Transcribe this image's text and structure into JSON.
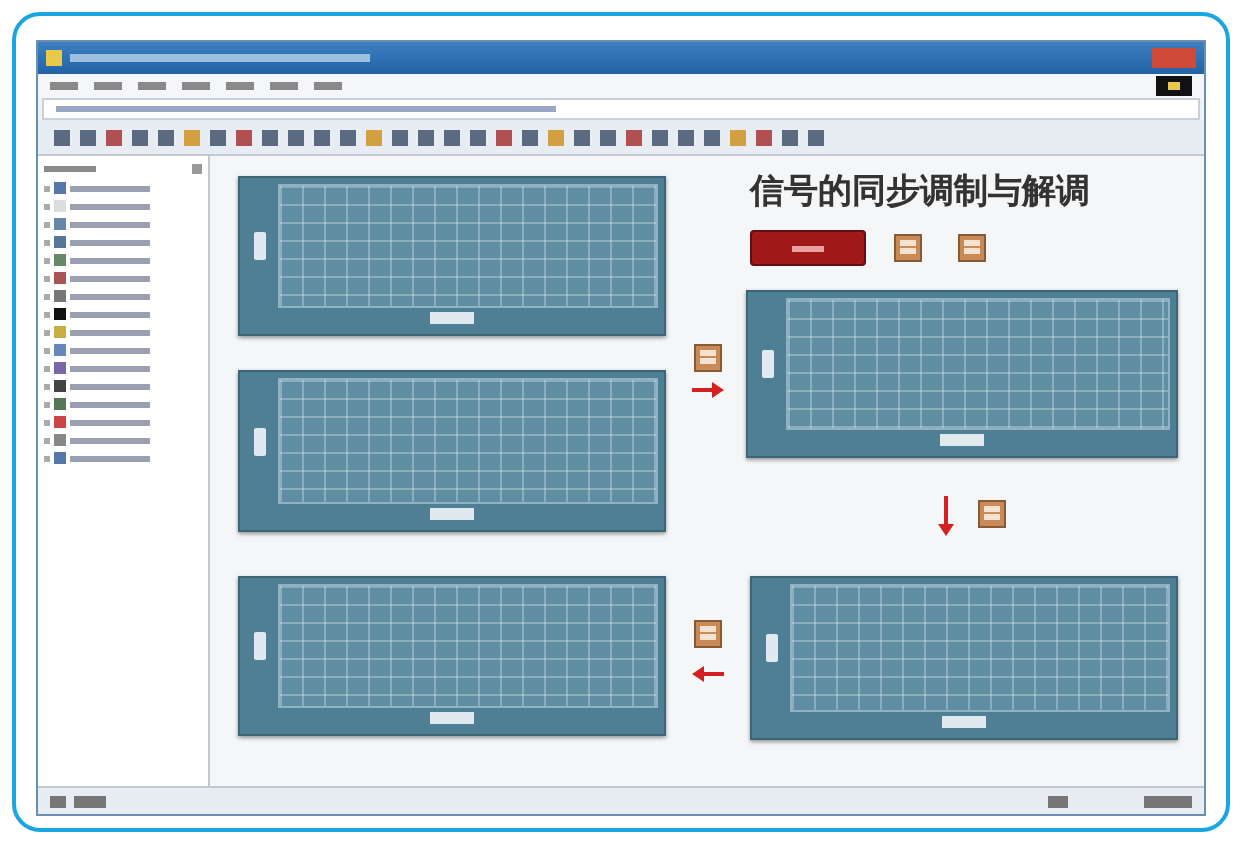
{
  "front_panel": {
    "title": "信号的同步调制与解调"
  }
}
